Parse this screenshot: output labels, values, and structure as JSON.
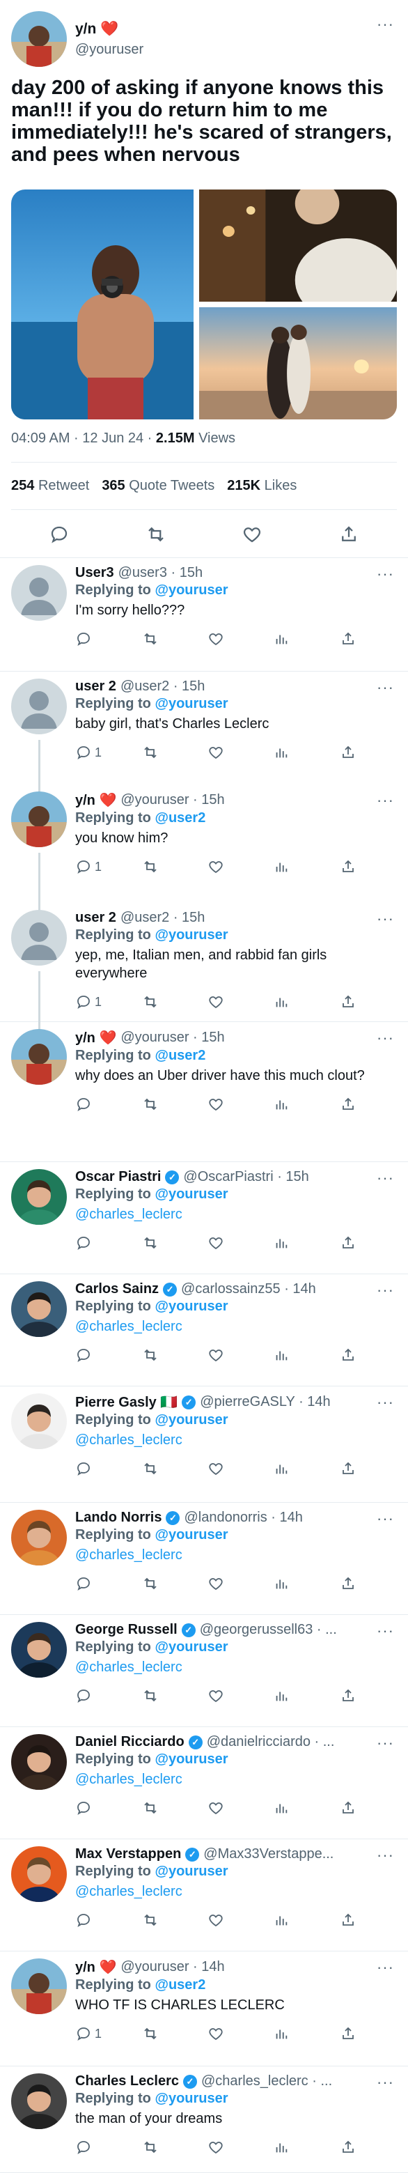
{
  "main_tweet": {
    "display_name": "y/n",
    "heart": "❤️",
    "username": "@youruser",
    "text": "day 200 of asking if anyone knows this man!!! if you do return him to me immediately!!! he's scared of strangers, and pees when nervous",
    "time": "04:09 AM · 12 Jun 24 ·",
    "views_count": "2.15M",
    "views_label": "Views",
    "retweets_count": "254",
    "retweets_label": "Retweet",
    "quotes_count": "365",
    "quotes_label": "Quote Tweets",
    "likes_count": "215K",
    "likes_label": "Likes",
    "more": "···"
  },
  "replying_label": "Replying to",
  "replies": [
    {
      "display_name": "User3",
      "username": "@user3 · 15h",
      "replying_to": "@youruser",
      "text": "I'm sorry hello???",
      "reply_count": "",
      "more": "···"
    },
    {
      "display_name": "user 2",
      "username": "@user2 · 15h",
      "replying_to": "@youruser",
      "text": "baby girl, that's Charles Leclerc",
      "reply_count": "1",
      "more": "···"
    },
    {
      "display_name": "y/n ❤️",
      "username": "@youruser · 15h",
      "replying_to": "@user2",
      "text": "you know him?",
      "reply_count": "1",
      "more": "···"
    },
    {
      "display_name": "user 2",
      "username": "@user2 · 15h",
      "replying_to": "@youruser",
      "text": "yep, me, Italian men, and rabbid fan girls everywhere",
      "reply_count": "1",
      "more": "···"
    },
    {
      "display_name": "y/n ❤️",
      "username": "@youruser · 15h",
      "replying_to": "@user2",
      "text": "why does an Uber driver have this much clout?",
      "reply_count": "",
      "more": "···"
    },
    {
      "display_name": "Oscar Piastri",
      "username": "@OscarPiastri · 15h",
      "replying_to": "@youruser",
      "text": "@charles_leclerc",
      "reply_count": "",
      "more": "···"
    },
    {
      "display_name": "Carlos Sainz",
      "username": "@carlossainz55 · 14h",
      "replying_to": "@youruser",
      "text": "@charles_leclerc",
      "reply_count": "",
      "more": "···"
    },
    {
      "display_name": "Pierre Gasly 🇮🇹",
      "username": "@pierreGASLY · 14h",
      "replying_to": "@youruser",
      "text": "@charles_leclerc",
      "reply_count": "",
      "more": "···"
    },
    {
      "display_name": "Lando Norris",
      "username": "@landonorris · 14h",
      "replying_to": "@youruser",
      "text": "@charles_leclerc",
      "reply_count": "",
      "more": "···"
    },
    {
      "display_name": "George Russell",
      "username": "@georgerussell63 · ...",
      "replying_to": "@youruser",
      "text": "@charles_leclerc",
      "reply_count": "",
      "more": "···"
    },
    {
      "display_name": "Daniel Ricciardo",
      "username": "@danielricciardo · ...",
      "replying_to": "@youruser",
      "text": "@charles_leclerc",
      "reply_count": "",
      "more": "···"
    },
    {
      "display_name": "Max Verstappen",
      "username": "@Max33Verstappe...",
      "replying_to": "@youruser",
      "text": "@charles_leclerc",
      "reply_count": "",
      "more": "···"
    },
    {
      "display_name": "y/n ❤️",
      "username": "@youruser · 14h",
      "replying_to": "@user2",
      "text": "WHO TF IS CHARLES LECLERC",
      "reply_count": "1",
      "more": "···"
    },
    {
      "display_name": "Charles Leclerc",
      "username": "@charles_leclerc · ...",
      "replying_to": "@youruser",
      "text": "the man of your dreams",
      "reply_count": "",
      "more": "···"
    }
  ],
  "colors": {
    "accent": "#1d9bf0",
    "muted": "#536471",
    "text": "#0f1419",
    "divider": "#e6ecf0"
  }
}
